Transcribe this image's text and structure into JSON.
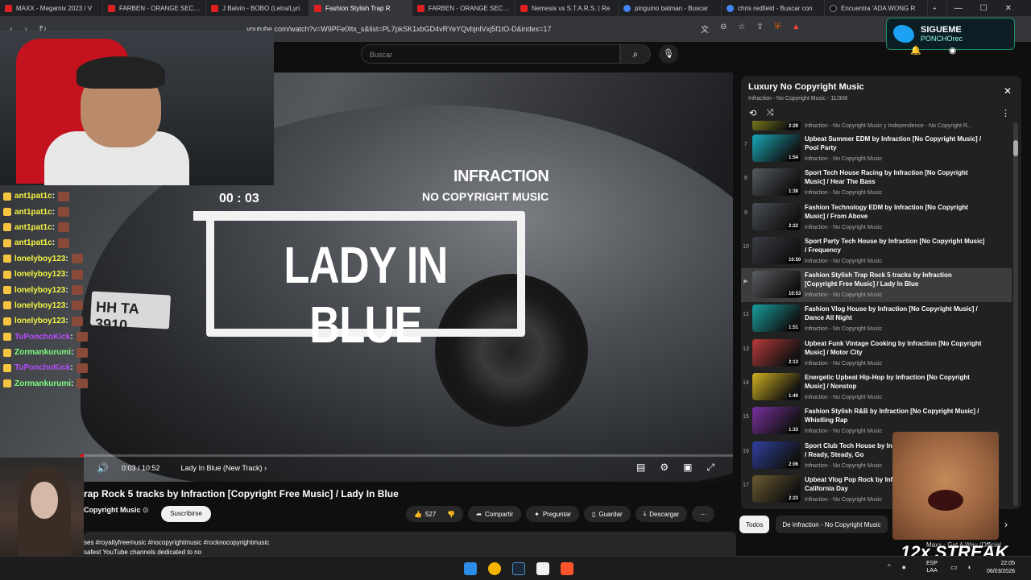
{
  "browser": {
    "tabs": [
      {
        "label": "MAXX - Megamix 2023 / V",
        "icon": "youtube-icon"
      },
      {
        "label": "FARBEN - ORANGE SECTO",
        "icon": "youtube-icon"
      },
      {
        "label": "J Balvin - BOBO (Letra/Lyri",
        "icon": "youtube-icon"
      },
      {
        "label": "Fashion Stylish Trap R",
        "icon": "youtube-icon"
      },
      {
        "label": "FARBEN - ORANGE SECTO",
        "icon": "youtube-icon"
      },
      {
        "label": "Nemesis vs S.T.A.R.S. | Re",
        "icon": "youtube-icon"
      },
      {
        "label": "pinguino batman - Buscar",
        "icon": "google-icon"
      },
      {
        "label": "chris redfield - Buscar con",
        "icon": "google-icon"
      },
      {
        "label": "Encuentra 'ADA WONG R",
        "icon": "tiktok-icon"
      }
    ],
    "url": "youtube.com/watch?v=W9PFe0Itx_s&list=PL7pkSK1xbGD4vRYeYQvbjnlVxj5f1tO-D&index=17"
  },
  "overlay": {
    "follow_title": "SIGUEME",
    "follow_handle": "PONCHOrec",
    "streak": "12x STREAK",
    "streak_caption": "Maxx - Get A Way (Official"
  },
  "chat": [
    {
      "user": "ant1pat1c",
      "color": "#f5f542"
    },
    {
      "user": "ant1pat1c",
      "color": "#f5f542"
    },
    {
      "user": "ant1pat1c",
      "color": "#f5f542"
    },
    {
      "user": "ant1pat1c",
      "color": "#f5f542"
    },
    {
      "user": "lonelyboy123",
      "color": "#f5f542"
    },
    {
      "user": "lonelyboy123",
      "color": "#f5f542"
    },
    {
      "user": "lonelyboy123",
      "color": "#f5f542"
    },
    {
      "user": "lonelyboy123",
      "color": "#f5f542"
    },
    {
      "user": "lonelyboy123",
      "color": "#f5f542"
    },
    {
      "user": "TuPonchoKick",
      "color": "#b84dff"
    },
    {
      "user": "Zormankurumi",
      "color": "#7dff7d"
    },
    {
      "user": "TuPonchoKick",
      "color": "#b84dff"
    },
    {
      "user": "Zormankurumi",
      "color": "#7dff7d"
    }
  ],
  "youtube": {
    "search_placeholder": "Buscar",
    "video": {
      "brand": "INFRACTION",
      "brand_sub": "NO COPYRIGHT MUSIC",
      "track_time": "00 : 03",
      "track_title": "LADY IN BLUE",
      "plate": "HH TA 3910",
      "time": "0:03 / 10:52",
      "chapter": "Lady In Blue (New Track)",
      "progress": 0.005
    },
    "title": "rap Rock 5 tracks by Infraction [Copyright Free Music] / Lady In Blue",
    "channel": "Copyright Music",
    "subscribe": "Suscribirse",
    "actions": {
      "likes": "527",
      "share": "Compartir",
      "ask": "Preguntar",
      "save": "Guardar",
      "download": "Descargar"
    },
    "description": [
      "ses #royaltyfreemusic #nocopyrightmusic #rocknocopyrightmusic",
      "safest YouTube channels dedicated to no"
    ],
    "playlist": {
      "title": "Luxury No Copyright Music",
      "subtitle": "Infraction - No Copyright Music - 11/308",
      "items": [
        {
          "n": "",
          "title": "",
          "channel": "Infraction - No Copyright Music y Independence - No Copyright R...",
          "duration": "2:29",
          "color": "#a0a020"
        },
        {
          "n": "7",
          "title": "Upbeat Summer EDM by Infraction [No Copyright Music] / Pool Party",
          "channel": "Infraction - No Copyright Music",
          "duration": "1:54",
          "color": "#18a8b8"
        },
        {
          "n": "8",
          "title": "Sport Tech House Racing by Infraction [No Copyright Music] / Hear The Bass",
          "channel": "Infraction - No Copyright Music",
          "duration": "1:38",
          "color": "#555a60"
        },
        {
          "n": "9",
          "title": "Fashion Technology EDM by Infraction [No Copyright Music] / From Above",
          "channel": "Infraction - No Copyright Music",
          "duration": "2:22",
          "color": "#4a4f55"
        },
        {
          "n": "10",
          "title": "Sport Party Tech House by Infraction [No Copyright Music] / Frequency",
          "channel": "Infraction - No Copyright Music",
          "duration": "10:50",
          "color": "#3a3d44"
        },
        {
          "n": "▶",
          "title": "Fashion Stylish Trap Rock 5 tracks by Infraction [Copyright Free Music] / Lady In Blue",
          "channel": "Infraction - No Copyright Music",
          "duration": "10:53",
          "color": "#5a5d62"
        },
        {
          "n": "12",
          "title": "Fashion Vlog House by Infraction [No Copyright Music] / Dance All Night",
          "channel": "Infraction - No Copyright Music",
          "duration": "1:51",
          "color": "#18a0a0"
        },
        {
          "n": "13",
          "title": "Upbeat Funk Vintage Cooking by Infraction [No Copyright Music] / Motor City",
          "channel": "Infraction - No Copyright Music",
          "duration": "2:13",
          "color": "#b83a3a"
        },
        {
          "n": "14",
          "title": "Energetic Upbeat Hip-Hop by Infraction [No Copyright Music] / Nonstop",
          "channel": "Infraction - No Copyright Music",
          "duration": "1:40",
          "color": "#d0b020"
        },
        {
          "n": "15",
          "title": "Fashion Stylish R&B by Infraction [No Copyright Music] / Whistling Rap",
          "channel": "Infraction - No Copyright Music",
          "duration": "1:33",
          "color": "#7a30a0"
        },
        {
          "n": "16",
          "title": "Sport Club Tech House by Infraction [No Copyright Music] / Ready, Steady, Go",
          "channel": "Infraction - No Copyright Music",
          "duration": "2:06",
          "color": "#3040a0"
        },
        {
          "n": "17",
          "title": "Upbeat Vlog Pop Rock by Infraction [No Copyright Music] / California Day",
          "channel": "Infraction - No Copyright Music",
          "duration": "2:23",
          "color": "#6a5a30"
        }
      ]
    },
    "chips": [
      "Todos",
      "De Infraction - No Copyright Music"
    ]
  },
  "taskbar": {
    "lang": "ESP",
    "lang2": "LAA",
    "time": "22:05",
    "date": "06/03/2026"
  }
}
